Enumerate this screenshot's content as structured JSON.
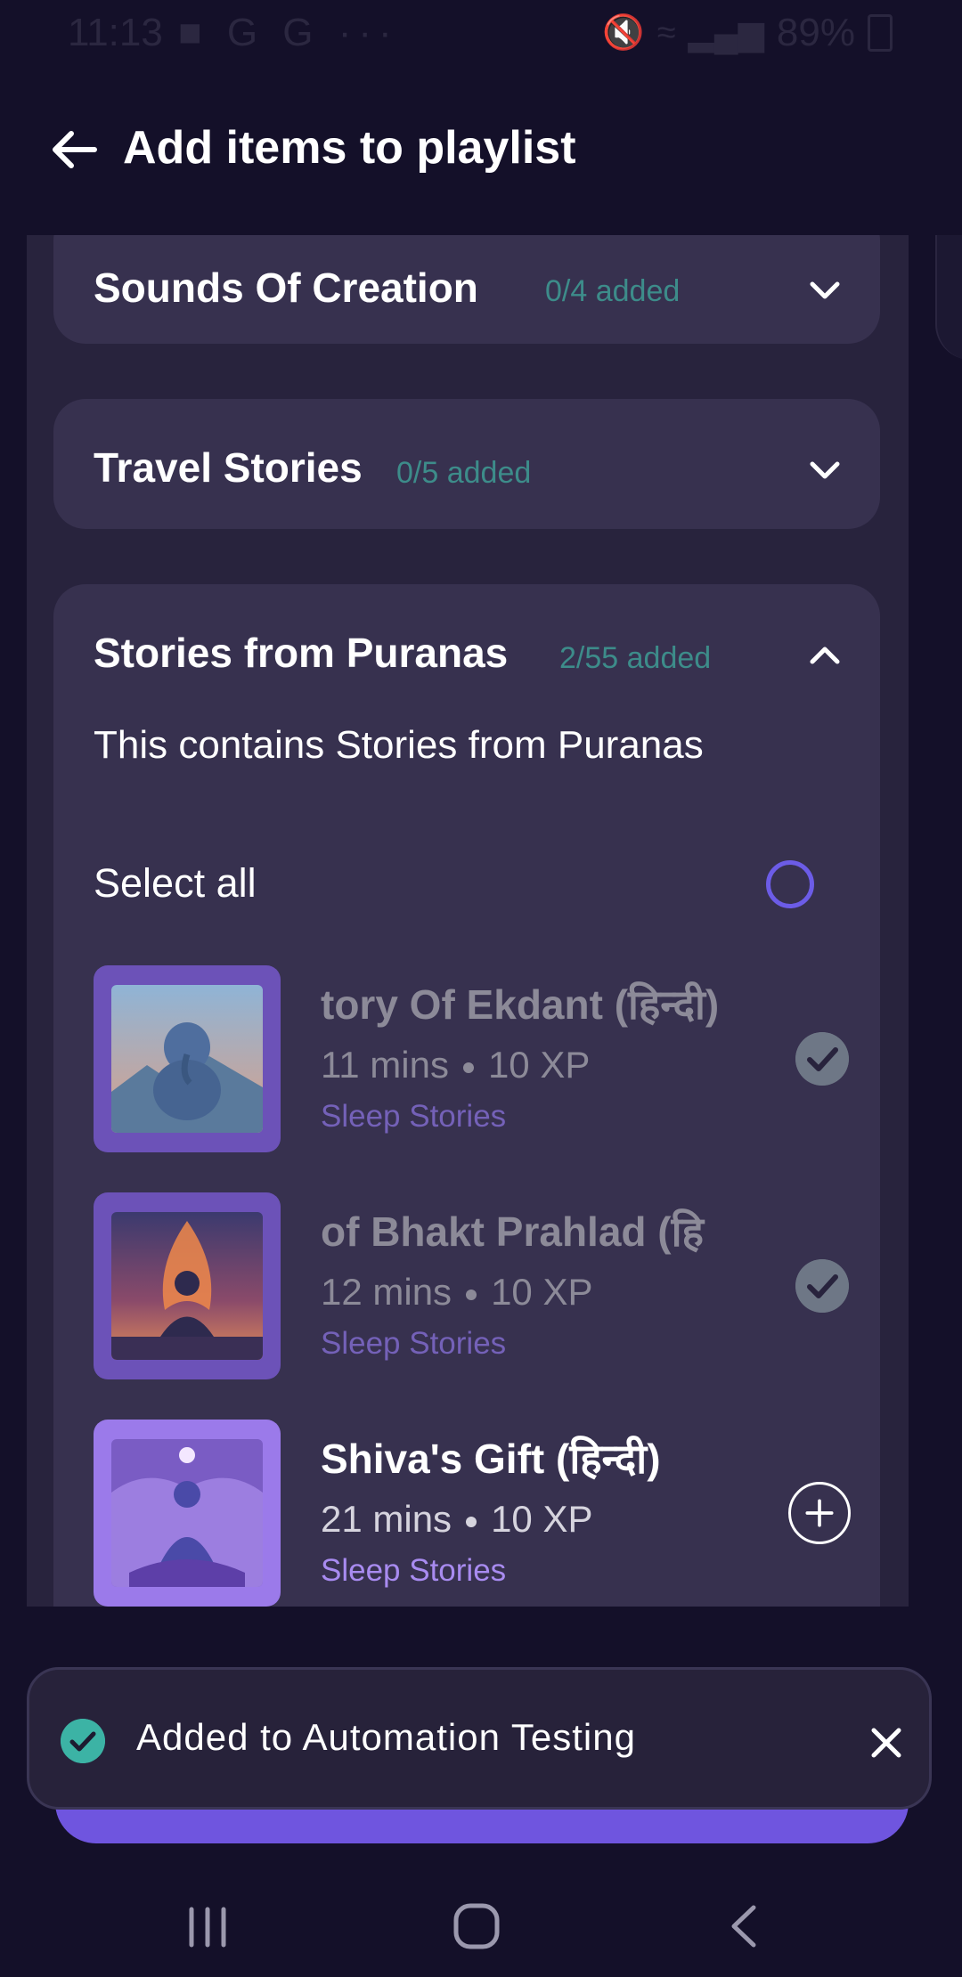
{
  "status_bar": {
    "time": "11:13",
    "app_icons": "G G",
    "dots": "···",
    "battery": "89%",
    "icons": [
      "teams-icon",
      "google-icon",
      "google-icon",
      "mute-icon",
      "wifi-icon",
      "signal-icon",
      "battery-charging-icon"
    ]
  },
  "header": {
    "title": "Add items to playlist"
  },
  "sections": [
    {
      "title": "Sounds Of Creation",
      "count": "0/4 added",
      "expanded": false
    },
    {
      "title": "Travel Stories",
      "count": "0/5 added",
      "expanded": false
    },
    {
      "title": "Stories from Puranas",
      "count": "2/55 added",
      "expanded": true,
      "description": "This contains Stories from Puranas",
      "select_all": "Select all"
    }
  ],
  "items": [
    {
      "title": "tory Of Ekdant (हिन्दी)",
      "duration": "11 mins",
      "xp": "10 XP",
      "category": "Sleep Stories",
      "added": true
    },
    {
      "title": "of Bhakt Prahlad (हि",
      "duration": "12 mins",
      "xp": "10 XP",
      "category": "Sleep Stories",
      "added": true
    },
    {
      "title": "Shiva's Gift (हिन्दी)",
      "duration": "21 mins",
      "xp": "10 XP",
      "category": "Sleep Stories",
      "added": false
    }
  ],
  "toast": {
    "message": "Added to Automation Testing"
  },
  "colors": {
    "background": "#141029",
    "card": "#37314f",
    "accent": "#6c5ce7",
    "count_teal": "#3d8c8a",
    "success": "#3cb3a5"
  }
}
